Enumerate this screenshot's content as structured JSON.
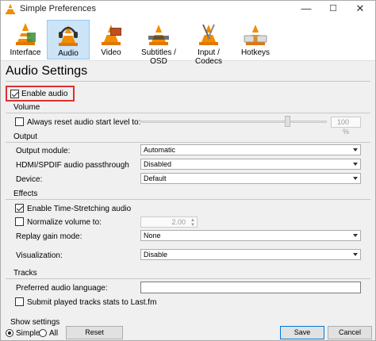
{
  "window": {
    "title": "Simple Preferences",
    "minimize": "—",
    "maximize": "☐",
    "close": "✕"
  },
  "toolbar": {
    "items": [
      {
        "label": "Interface",
        "icon": "cone-interface-icon"
      },
      {
        "label": "Audio",
        "icon": "cone-headphones-icon"
      },
      {
        "label": "Video",
        "icon": "cone-video-icon"
      },
      {
        "label": "Subtitles / OSD",
        "icon": "cone-subtitles-icon"
      },
      {
        "label": "Input / Codecs",
        "icon": "cone-input-icon"
      },
      {
        "label": "Hotkeys",
        "icon": "cone-hotkeys-icon"
      }
    ],
    "active": "Audio"
  },
  "page": {
    "title": "Audio Settings"
  },
  "enable_audio": {
    "label": "Enable audio",
    "checked": true
  },
  "volume": {
    "group": "Volume",
    "reset_label": "Always reset audio start level to:",
    "reset_checked": false,
    "level_value": "100 %",
    "level_fraction": 0.8
  },
  "output": {
    "group": "Output",
    "module_label": "Output module:",
    "module_value": "Automatic",
    "hdmi_label": "HDMI/SPDIF audio passthrough",
    "hdmi_value": "Disabled",
    "device_label": "Device:",
    "device_value": "Default"
  },
  "effects": {
    "group": "Effects",
    "time_stretch_label": "Enable Time-Stretching audio",
    "time_stretch_checked": true,
    "normalize_label": "Normalize volume to:",
    "normalize_checked": false,
    "normalize_value": "2.00",
    "replay_label": "Replay gain mode:",
    "replay_value": "None",
    "visual_label": "Visualization:",
    "visual_value": "Disable"
  },
  "tracks": {
    "group": "Tracks",
    "pref_lang_label": "Preferred audio language:",
    "pref_lang_value": "",
    "lastfm_label": "Submit played tracks stats to Last.fm",
    "lastfm_checked": false
  },
  "bottom": {
    "show_settings": "Show settings",
    "simple": "Simple",
    "all": "All",
    "reset": "Reset Preferences",
    "save": "Save",
    "cancel": "Cancel"
  },
  "colors": {
    "accent": "#0078d7",
    "highlight_border": "#e03030",
    "active_tab": "#cce4f7"
  }
}
